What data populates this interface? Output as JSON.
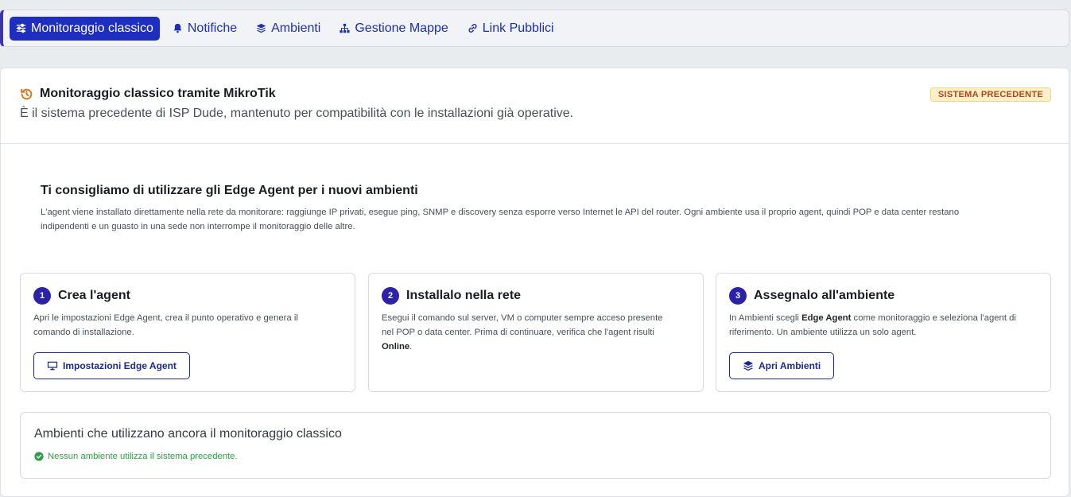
{
  "nav": {
    "items": [
      {
        "label": "Monitoraggio classico",
        "icon": "sliders-icon",
        "active": true
      },
      {
        "label": "Notifiche",
        "icon": "bell-icon",
        "active": false
      },
      {
        "label": "Ambienti",
        "icon": "layers-icon",
        "active": false
      },
      {
        "label": "Gestione Mappe",
        "icon": "sitemap-icon",
        "active": false
      },
      {
        "label": "Link Pubblici",
        "icon": "link-icon",
        "active": false
      }
    ]
  },
  "header": {
    "title": "Monitoraggio classico tramite MikroTik",
    "subtitle": "È il sistema precedente di ISP Dude, mantenuto per compatibilità con le installazioni già operative.",
    "badge": "SISTEMA PRECEDENTE",
    "icon": "history-icon"
  },
  "recommendation": {
    "title": "Ti consigliamo di utilizzare gli Edge Agent per i nuovi ambienti",
    "line1": "L'agent viene installato direttamente nella rete da monitorare: raggiunge IP privati, esegue ping, SNMP e discovery senza esporre verso Internet le API del router. Ogni ambiente usa il proprio agent, quindi POP e data center restano",
    "line2": "indipendenti e un guasto in una sede non interrompe il monitoraggio delle altre."
  },
  "steps": [
    {
      "number": "1",
      "title": "Crea l'agent",
      "desc1": "Apri le impostazioni Edge Agent, crea il punto operativo e genera il",
      "desc2": "comando di installazione.",
      "button": "Impostazioni Edge Agent",
      "button_icon": "monitor-icon"
    },
    {
      "number": "2",
      "title": "Installalo nella rete",
      "desc1": "Esegui il comando sul server, VM o computer sempre acceso presente",
      "desc2": "nel POP o data center. Prima di continuare, verifica che l'agent risulti",
      "desc3_bold": "Online",
      "desc3_tail": "."
    },
    {
      "number": "3",
      "title": "Assegnalo all'ambiente",
      "desc1_pre": "In Ambienti scegli ",
      "desc1_bold": "Edge Agent",
      "desc1_post": " come monitoraggio e seleziona l'agent di",
      "desc2": "riferimento. Un ambiente utilizza un solo agent.",
      "button": "Apri Ambienti",
      "button_icon": "layers-icon"
    }
  ],
  "environments": {
    "title": "Ambienti che utilizzano ancora il monitoraggio classico",
    "status": "Nessun ambiente utilizza il sistema precedente.",
    "status_icon": "check-circle-icon"
  },
  "colors": {
    "accent": "#1e2fc0",
    "badge_bg": "#fdf0c8",
    "badge_text": "#b5451b",
    "success": "#2f9e44"
  }
}
